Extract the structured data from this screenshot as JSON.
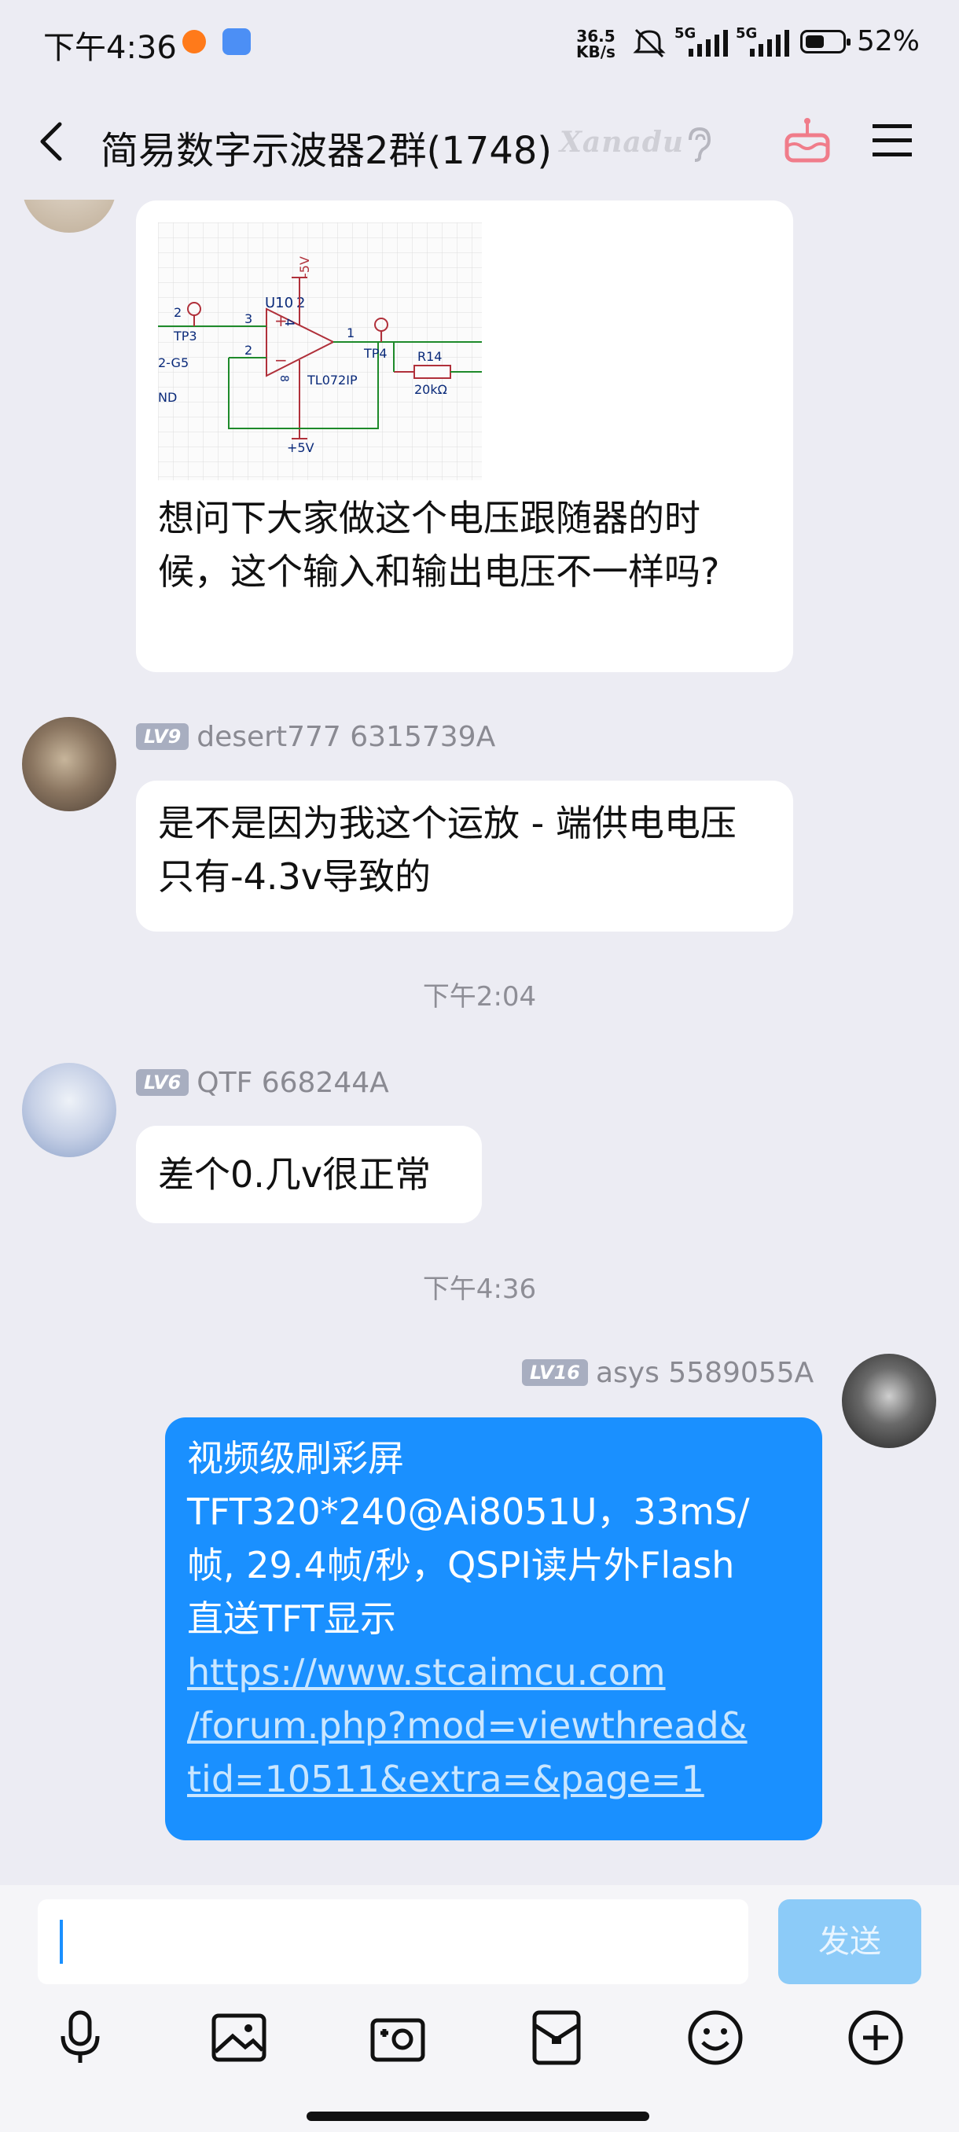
{
  "status": {
    "time": "下午4:36",
    "net_rate_value": "36.5",
    "net_rate_unit": "KB/s",
    "network_1": "5G",
    "network_2": "5G",
    "battery": "52%",
    "battery_level": 0.52
  },
  "header": {
    "title": "简易数字示波器2群(1748)",
    "badge": "Xanadu"
  },
  "messages": [
    {
      "id": "m1",
      "schematic": {
        "u_label": "U10",
        "pin_top": "4",
        "pin_top2": "2",
        "rail_neg": "-5V",
        "rail_pos": "+5V",
        "tp_in": "TP3",
        "tp_out": "TP4",
        "pin2_left": "2",
        "pin3": "3",
        "pin2": "2",
        "pin1": "1",
        "pin8": "8",
        "net_g5": "2-G5",
        "net_nd": "ND",
        "chip": "TL072IP",
        "resistor": "R14",
        "resistor_value": "20kΩ",
        "plus": "+",
        "minus": "−"
      },
      "text": "想问下大家做这个电压跟随器的时候，这个输入和输出电压不一样吗?"
    },
    {
      "id": "m2",
      "level": "LV9",
      "name": "desert777 6315739A",
      "text": "是不是因为我这个运放 - 端供电电压只有-4.3v导致的"
    },
    {
      "id": "t1",
      "timestamp": "下午2:04"
    },
    {
      "id": "m3",
      "level": "LV6",
      "name": "QTF 668244A",
      "text": "差个0.几v很正常"
    },
    {
      "id": "t2",
      "timestamp": "下午4:36"
    },
    {
      "id": "m4",
      "level": "LV16",
      "name": "asys  5589055A",
      "text_lines": [
        "视频级刷彩屏",
        "TFT320*240@Ai8051U，33mS/",
        "帧, 29.4帧/秒，QSPI读片外Flash",
        "直送TFT显示"
      ],
      "link_lines": [
        "https://www.stcaimcu.com",
        "/forum.php?mod=viewthread&",
        "tid=10511&extra=&page=1"
      ]
    }
  ],
  "input": {
    "placeholder": "",
    "send_label": "发送"
  },
  "toolbar": [
    "mic-icon",
    "photo-icon",
    "camera-icon",
    "red-packet-icon",
    "emoji-icon",
    "plus-icon"
  ]
}
